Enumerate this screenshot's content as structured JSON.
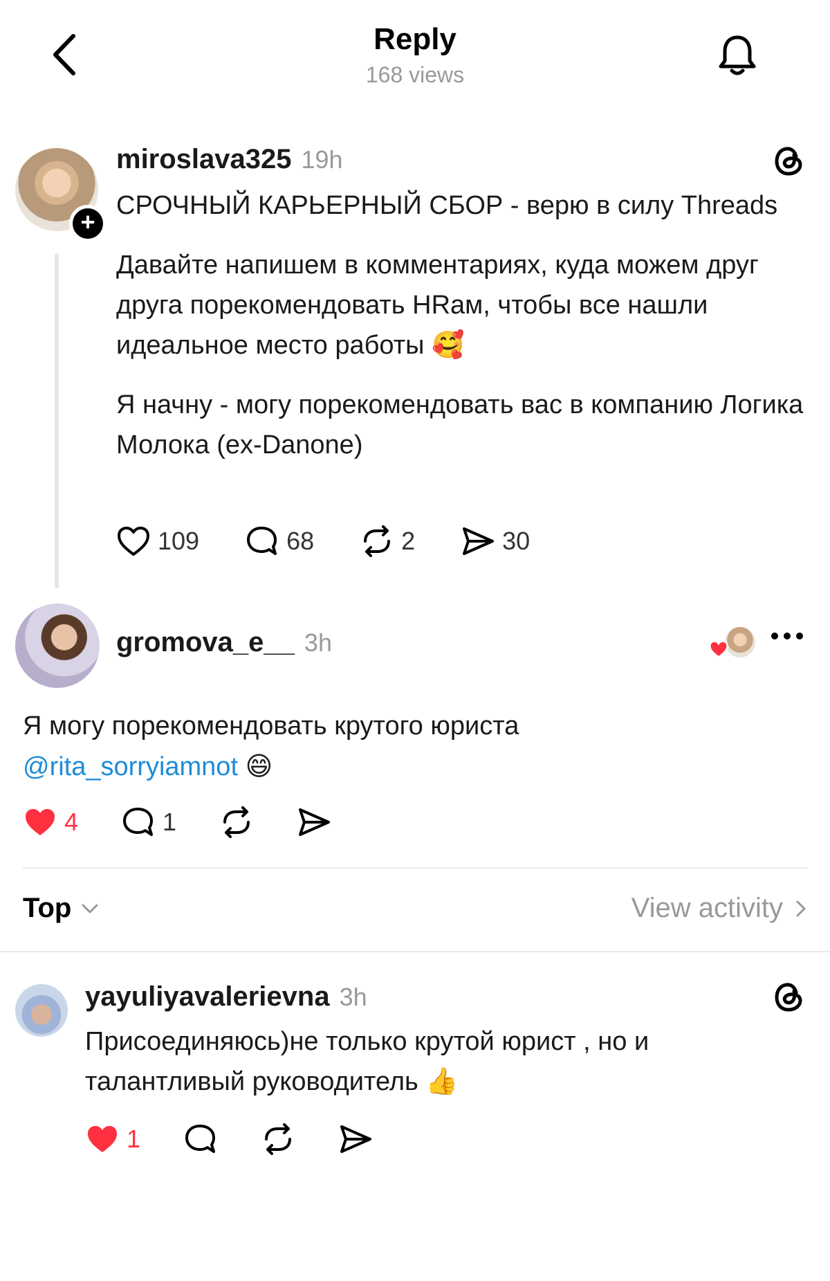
{
  "header": {
    "title": "Reply",
    "views": "168 views"
  },
  "main_post": {
    "username": "miroslava325",
    "time": "19h",
    "paragraphs": [
      "СРОЧНЫЙ КАРЬЕРНЫЙ СБОР - верю в силу Threads",
      "Давайте напишем в комментариях, куда можем друг друга порекомендовать HRам, чтобы все нашли идеальное место работы 🥰",
      "Я начну - могу порекомендовать вас в компанию Логика Молока (ex-Danone)"
    ],
    "likes": "109",
    "comments": "68",
    "reposts": "2",
    "shares": "30"
  },
  "reply": {
    "username": "gromova_e__",
    "time": "3h",
    "text": "Я могу порекомендовать крутого юриста",
    "mention": "@rita_sorryiamnot",
    "emoji": "😄",
    "likes": "4",
    "comments": "1"
  },
  "sort": {
    "label": "Top",
    "view_activity": "View activity"
  },
  "comment": {
    "username": "yayuliyavalerievna",
    "time": "3h",
    "text": "Присоединяюсь)не только  крутой юрист , но и талантливый руководитель 👍",
    "likes": "1"
  },
  "colors": {
    "like_red": "#ff3040",
    "mention_blue": "#1d8cd8",
    "muted_gray": "#999999"
  }
}
